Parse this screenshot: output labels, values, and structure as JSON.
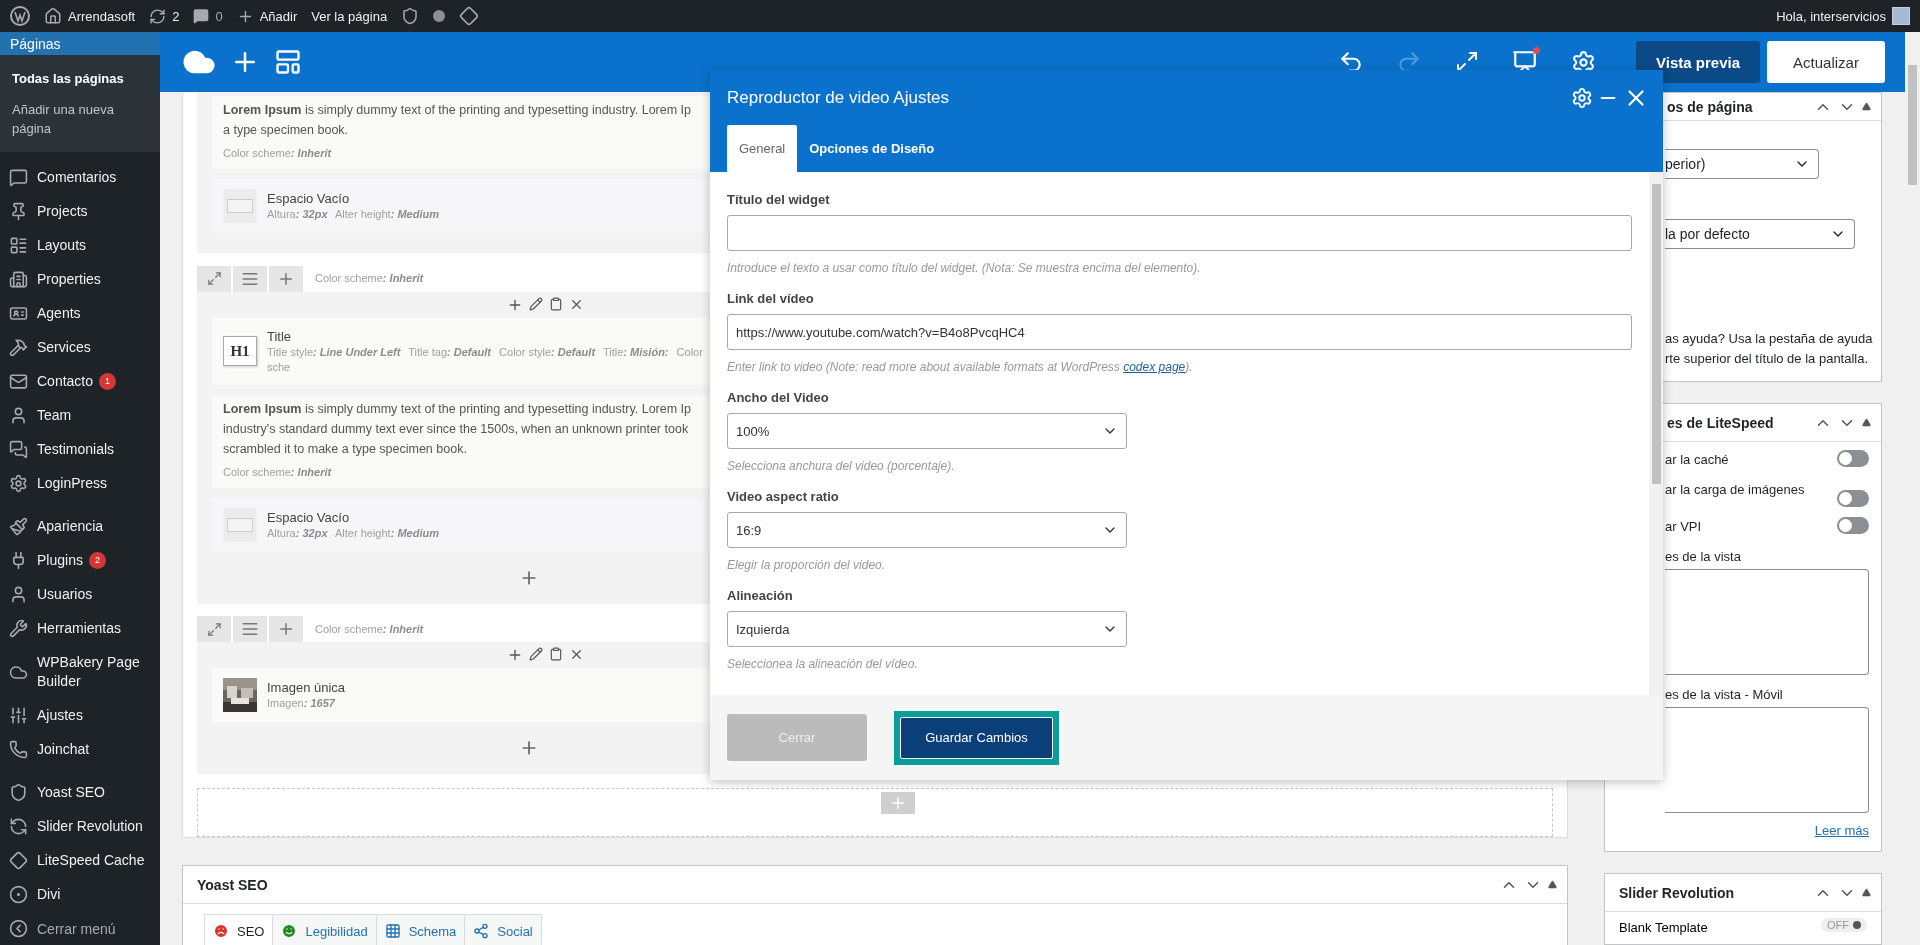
{
  "admin_bar": {
    "site": "Arrendasoft",
    "updates": "2",
    "comments": "0",
    "add": "Añadir",
    "view": "Ver la página",
    "greeting": "Hola, interservicios"
  },
  "sidebar": {
    "current": {
      "label": "Páginas",
      "selected": true
    },
    "submenu": [
      {
        "label": "Todas las páginas",
        "selected": true
      },
      {
        "label": "Añadir una nueva página",
        "selected": false
      }
    ],
    "groups": [
      [
        {
          "label": "Comentarios",
          "selected": false
        },
        {
          "label": "Projects",
          "selected": false
        },
        {
          "label": "Layouts",
          "selected": false
        },
        {
          "label": "Properties",
          "selected": false
        },
        {
          "label": "Agents",
          "selected": false
        },
        {
          "label": "Services",
          "selected": false
        },
        {
          "label": "Contacto",
          "badge": "1",
          "selected": false
        },
        {
          "label": "Team",
          "selected": false
        },
        {
          "label": "Testimonials",
          "selected": false
        },
        {
          "label": "LoginPress",
          "selected": false
        }
      ],
      [
        {
          "label": "Apariencia",
          "selected": false
        },
        {
          "label": "Plugins",
          "badge": "2",
          "selected": false
        },
        {
          "label": "Usuarios",
          "selected": false
        },
        {
          "label": "Herramientas",
          "selected": false
        },
        {
          "label": "WPBakery Page Builder",
          "selected": false
        },
        {
          "label": "Ajustes",
          "selected": false
        },
        {
          "label": "Joinchat",
          "selected": false
        }
      ],
      [
        {
          "label": "Yoast SEO",
          "selected": false
        },
        {
          "label": "Slider Revolution",
          "selected": false
        },
        {
          "label": "LiteSpeed Cache",
          "selected": false
        },
        {
          "label": "Divi",
          "selected": false
        }
      ]
    ],
    "collapse": "Cerrar menú"
  },
  "toolbar": {
    "preview": "Vista previa",
    "update": "Actualizar",
    "redo_disabled": true,
    "notice": true
  },
  "builder": {
    "rows": [
      {
        "add_button": false,
        "elements": [
          {
            "kind": "text",
            "lines": [
              "**Lorem Ipsum** is simply dummy text of the printing and typesetting industry. Lorem Ip",
              "a type specimen book."
            ],
            "meta": [
              {
                "label": "Color scheme",
                "value": ": Inherit"
              }
            ]
          },
          {
            "kind": "spacer",
            "name": "Espacio Vacío",
            "meta": [
              {
                "label": "Altura",
                "value": ": 32px"
              },
              {
                "label": "Alter height",
                "value": ": Medium"
              }
            ]
          }
        ]
      },
      {
        "add_button": true,
        "controls": {
          "meta": [
            {
              "label": "Color scheme",
              "value": ": Inherit"
            }
          ]
        },
        "elements": [
          {
            "kind": "title",
            "badge": "H1",
            "name": "Title",
            "meta": [
              {
                "label": "Title style",
                "value": ": Line Under Left"
              },
              {
                "label": "Title tag",
                "value": ": Default"
              },
              {
                "label": "Color style",
                "value": ": Default"
              },
              {
                "label": "Title",
                "value": ": Misión:"
              },
              {
                "label": "Color sche"
              }
            ]
          },
          {
            "kind": "text",
            "lines": [
              "**Lorem Ipsum** is simply dummy text of the printing and typesetting industry. Lorem Ip",
              "industry's standard dummy text ever since the 1500s, when an unknown printer took",
              "scrambled it to make a type specimen book."
            ],
            "meta": [
              {
                "label": "Color scheme",
                "value": ": Inherit"
              }
            ]
          },
          {
            "kind": "spacer",
            "name": "Espacio Vacío",
            "meta": [
              {
                "label": "Altura",
                "value": ": 32px"
              },
              {
                "label": "Alter height",
                "value": ": Medium"
              }
            ]
          }
        ]
      },
      {
        "add_button": true,
        "controls": {
          "meta": [
            {
              "label": "Color scheme",
              "value": ": Inherit"
            }
          ]
        },
        "elements": [
          {
            "name": "Imagen única",
            "meta": [
              {
                "label": "Imagen",
                "value": ": 1657"
              }
            ]
          }
        ]
      }
    ]
  },
  "modal": {
    "title": "Reproductor de video Ajustes",
    "tabs": [
      {
        "label": "General",
        "selected": true
      },
      {
        "label": "Opciones de Diseño",
        "selected": false
      }
    ],
    "fields": [
      {
        "kind": "text",
        "label": "Título del widget",
        "help": "Introduce el texto a usar como título del widget. (Nota: Se muestra encima del elemento)."
      },
      {
        "kind": "text",
        "label": "Link del vídeo",
        "value": "https://www.youtube.com/watch?v=B4o8PvcqHC4",
        "help": "Enter link to video (Note: read more about available formats at WordPress ",
        "help_link": "codex page",
        "help_end": ")."
      },
      {
        "kind": "select",
        "label": "Ancho del Video",
        "value": "100%",
        "help": "Selecciona anchura del video (porcentaje)."
      },
      {
        "kind": "select",
        "label": "Video aspect ratio",
        "value": "16:9",
        "help": "Elegir la proporción del video."
      },
      {
        "kind": "select",
        "label": "Alineación",
        "value": "Izquierda",
        "help": "Seleccionea la alineación del vídeo."
      }
    ],
    "close": "Cerrar",
    "save": "Guardar Cambios",
    "save_highlighted": true
  },
  "side_panels": [
    {
      "kind": "attributes",
      "title": "os de página",
      "selects": [
        "perior)",
        "la por defecto"
      ],
      "help_lines": [
        "as ayuda? Usa la pestaña de ayuda",
        "rte superior del título de la pantalla."
      ]
    },
    {
      "kind": "litespeed",
      "title": "es de LiteSpeed",
      "toggles": [
        {
          "label": "ar la caché",
          "on": false
        },
        {
          "label": "ar la carga de imágenes",
          "on": false
        },
        {
          "label": "ar VPI",
          "on": false
        }
      ],
      "areas": [
        "es de la vista",
        "es de la vista - Móvil"
      ],
      "link": "Leer más"
    },
    {
      "kind": "slider",
      "title": "Slider Revolution",
      "rows": [
        {
          "label": "Blank Template",
          "state": "OFF",
          "on": false
        }
      ]
    }
  ],
  "yoast": {
    "title": "Yoast SEO",
    "tabs": [
      {
        "label": "SEO",
        "selected": true
      },
      {
        "label": "Legibilidad",
        "selected": false
      },
      {
        "label": "Schema",
        "selected": false
      },
      {
        "label": "Social",
        "selected": false
      }
    ]
  }
}
